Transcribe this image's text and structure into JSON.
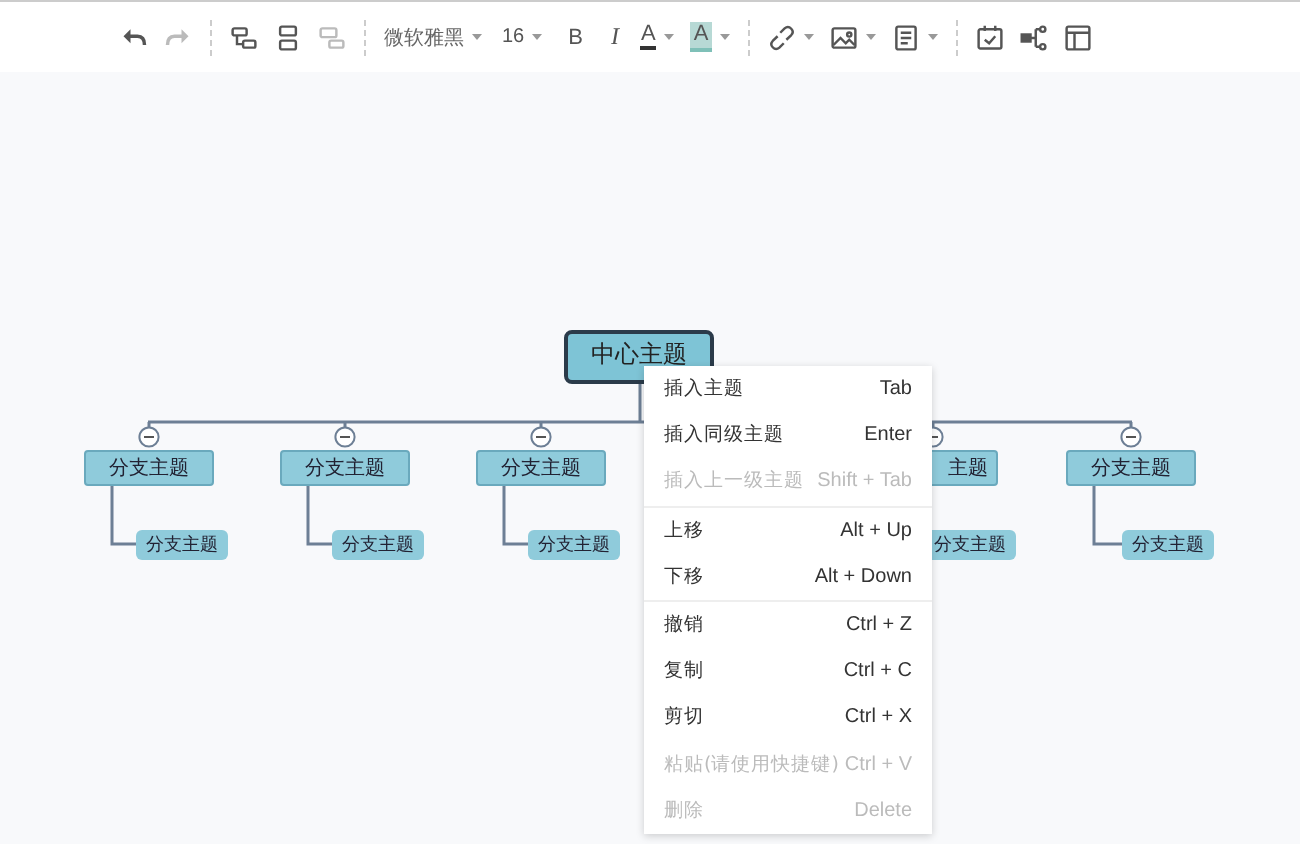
{
  "toolbar": [
    {
      "kind": "icon",
      "dropdown": false,
      "disabled": false
    },
    {
      "kind": "icon",
      "dropdown": false,
      "disabled": true
    },
    {
      "kind": "separator"
    },
    {
      "kind": "icon",
      "dropdown": false,
      "disabled": false
    },
    {
      "kind": "icon",
      "dropdown": false,
      "disabled": false
    },
    {
      "kind": "icon",
      "dropdown": false,
      "disabled": true
    },
    {
      "kind": "separator"
    },
    {
      "kind": "font",
      "text": "微软雅黑",
      "dropdown": true,
      "disabled": false
    },
    {
      "kind": "size",
      "text": "16",
      "dropdown": true,
      "disabled": false
    },
    {
      "kind": "bold",
      "text": "B",
      "dropdown": false,
      "disabled": false
    },
    {
      "kind": "italic",
      "text": "I",
      "dropdown": false,
      "disabled": false
    },
    {
      "kind": "font-color",
      "text": "A",
      "dropdown": true,
      "disabled": false
    },
    {
      "kind": "highlight",
      "text": "A",
      "dropdown": true,
      "disabled": false
    },
    {
      "kind": "separator"
    },
    {
      "kind": "icon",
      "dropdown": true,
      "disabled": false
    },
    {
      "kind": "icon",
      "dropdown": true,
      "disabled": false
    },
    {
      "kind": "icon",
      "dropdown": true,
      "disabled": false
    },
    {
      "kind": "separator"
    },
    {
      "kind": "icon",
      "dropdown": false,
      "disabled": false
    },
    {
      "kind": "icon",
      "dropdown": false,
      "disabled": false
    },
    {
      "kind": "icon",
      "dropdown": false,
      "disabled": false
    }
  ],
  "mindmap": {
    "root": {
      "text": "中心主题",
      "selected": true
    },
    "branches": [
      {
        "text": "分支主题",
        "expanded": true,
        "children": [
          {
            "text": "分支主题"
          }
        ]
      },
      {
        "text": "分支主题",
        "expanded": true,
        "children": [
          {
            "text": "分支主题"
          }
        ]
      },
      {
        "text": "分支主题",
        "expanded": true,
        "children": [
          {
            "text": "分支主题"
          }
        ]
      },
      {
        "text": "主题",
        "expanded": true,
        "children": [
          {
            "text": "分支主题"
          }
        ]
      },
      {
        "text": "分支主题",
        "expanded": true,
        "children": [
          {
            "text": "分支主题"
          }
        ]
      }
    ]
  },
  "context_menu": {
    "groups": [
      [
        {
          "label": "插入主题",
          "shortcut": "Tab",
          "disabled": false
        },
        {
          "label": "插入同级主题",
          "shortcut": "Enter",
          "disabled": false
        },
        {
          "label": "插入上一级主题",
          "shortcut": "Shift + Tab",
          "disabled": true
        }
      ],
      [
        {
          "label": "上移",
          "shortcut": "Alt + Up",
          "disabled": false
        },
        {
          "label": "下移",
          "shortcut": "Alt + Down",
          "disabled": false
        }
      ],
      [
        {
          "label": "撤销",
          "shortcut": "Ctrl + Z",
          "disabled": false
        },
        {
          "label": "复制",
          "shortcut": "Ctrl + C",
          "disabled": false
        },
        {
          "label": "剪切",
          "shortcut": "Ctrl + X",
          "disabled": false
        },
        {
          "label": "粘贴(请使用快捷键)",
          "shortcut": "Ctrl + V",
          "disabled": true
        },
        {
          "label": "删除",
          "shortcut": "Delete",
          "disabled": true
        }
      ]
    ]
  }
}
